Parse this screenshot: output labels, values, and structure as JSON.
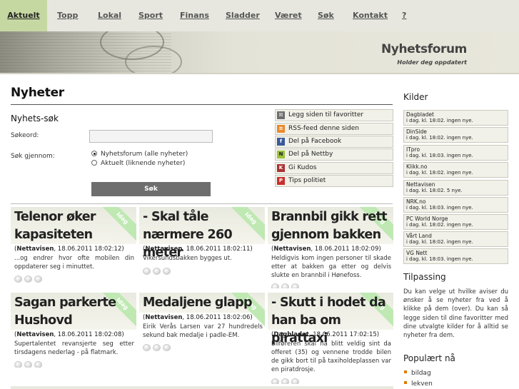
{
  "nav": {
    "items": [
      {
        "label": "Aktuelt"
      },
      {
        "label": "Topp"
      },
      {
        "label": "Lokal"
      },
      {
        "label": "Sport"
      },
      {
        "label": "Finans"
      },
      {
        "label": "Sladder"
      },
      {
        "label": "Været"
      },
      {
        "label": "Søk"
      },
      {
        "label": "Kontakt"
      },
      {
        "label": "?"
      }
    ]
  },
  "banner": {
    "site_title": "Nyhetsforum",
    "tagline": "Holder deg oppdatert"
  },
  "main": {
    "title": "Nyheter",
    "search": {
      "heading": "Nyhets-søk",
      "keyword_label": "Søkeord:",
      "keyword_value": "",
      "scope_label": "Søk gjennom:",
      "options": [
        {
          "label": "Nyhetsforum (alle nyheter)",
          "selected": true
        },
        {
          "label": "Aktuelt (liknende nyheter)",
          "selected": false
        }
      ],
      "button": "Søk"
    },
    "share": [
      {
        "icon": "favorite-icon",
        "label": "Legg siden til favoritter"
      },
      {
        "icon": "rss-icon",
        "label": "RSS-feed denne siden"
      },
      {
        "icon": "facebook-icon",
        "label": "Del på Facebook"
      },
      {
        "icon": "nettby-icon",
        "label": "Del på Nettby"
      },
      {
        "icon": "kudos-icon",
        "label": "Gi Kudos"
      },
      {
        "icon": "police-tip-icon",
        "label": "Tips politiet"
      }
    ],
    "news": [
      {
        "title": "Telenor øker kapasiteten",
        "badge": "Idag",
        "source": "Nettavisen",
        "date": ", 18.06.2011 18:02:12)",
        "text": "...og endrer hvor ofte mobilen din oppdaterer seg i minuttet."
      },
      {
        "title": "- Skal tåle nærmere 260 meter",
        "badge": "Idag",
        "source": "Nettavisen",
        "date": ", 18.06.2011 18:02:11)",
        "text": "Vikersundsbakken bygges ut."
      },
      {
        "title": "Brannbil gikk rett gjennom bakken",
        "badge": "Idag",
        "source": "Nettavisen",
        "date": ", 18.06.2011 18:02:09)",
        "text": "Heldigvis kom ingen personer til skade etter at bakken ga etter og delvis slukte en brannbil i Hønefoss."
      },
      {
        "title": "Sagan parkerte Hushovd",
        "badge": "Idag",
        "source": "Nettavisen",
        "date": ", 18.06.2011 18:02:08)",
        "text": "Supertalentet revansjerte seg etter tirsdagens nederlag - på flatmark."
      },
      {
        "title": "Medaljene glapp",
        "badge": "Idag",
        "source": "Nettavisen",
        "date": ", 18.06.2011 18:02:06)",
        "text": "Eirik Verås Larsen var 27 hundredels sekund bak medalje i padle-EM."
      },
      {
        "title": "- Skutt i hodet da han ba om pirattaxi",
        "badge": "Idag",
        "source": "Dagbladet",
        "date": ", 18.06.2011 17:02:15)",
        "text": "Bilføreren skal ha blitt veldig sint da offeret (35) og vennene trodde bilen de gikk bort til på taxiholdeplassen var en piratdrosje."
      }
    ]
  },
  "sidebar": {
    "kilder_title": "Kilder",
    "sources": [
      {
        "name": "Dagbladet",
        "update": "i dag. kl. 18:02. ingen nye."
      },
      {
        "name": "DinSide",
        "update": "i dag. kl. 18:02. ingen nye."
      },
      {
        "name": "ITpro",
        "update": "i dag. kl. 18:03. ingen nye."
      },
      {
        "name": "Klikk.no",
        "update": "i dag. kl. 18:02. ingen nye."
      },
      {
        "name": "Nettavisen",
        "update": "i dag. kl. 18:02. 5 nye."
      },
      {
        "name": "NRK.no",
        "update": "i dag. kl. 18:03. ingen nye."
      },
      {
        "name": "PC World Norge",
        "update": "i dag. kl. 18:02. ingen nye."
      },
      {
        "name": "Vårt Land",
        "update": "i dag. kl. 18:02. ingen nye."
      },
      {
        "name": "VG Nett",
        "update": "i dag. kl. 18:03. ingen nye."
      }
    ],
    "tilpassing_title": "Tilpassing",
    "tilpassing_text": "Du kan velge ut hvilke aviser du ønsker å se nyheter fra ved å klikke på dem (over). Du kan så legge siden til dine favoritter med dine utvalgte kilder for å alltid se nyheter fra dem.",
    "popular_title": "Populært nå",
    "popular": [
      "bildag",
      "lekven"
    ]
  },
  "colors": {
    "nav_bg": "#e7e7df",
    "nav_active": "#c6d8a2",
    "badge": "#bfe8b3",
    "button": "#6d6e6d"
  }
}
